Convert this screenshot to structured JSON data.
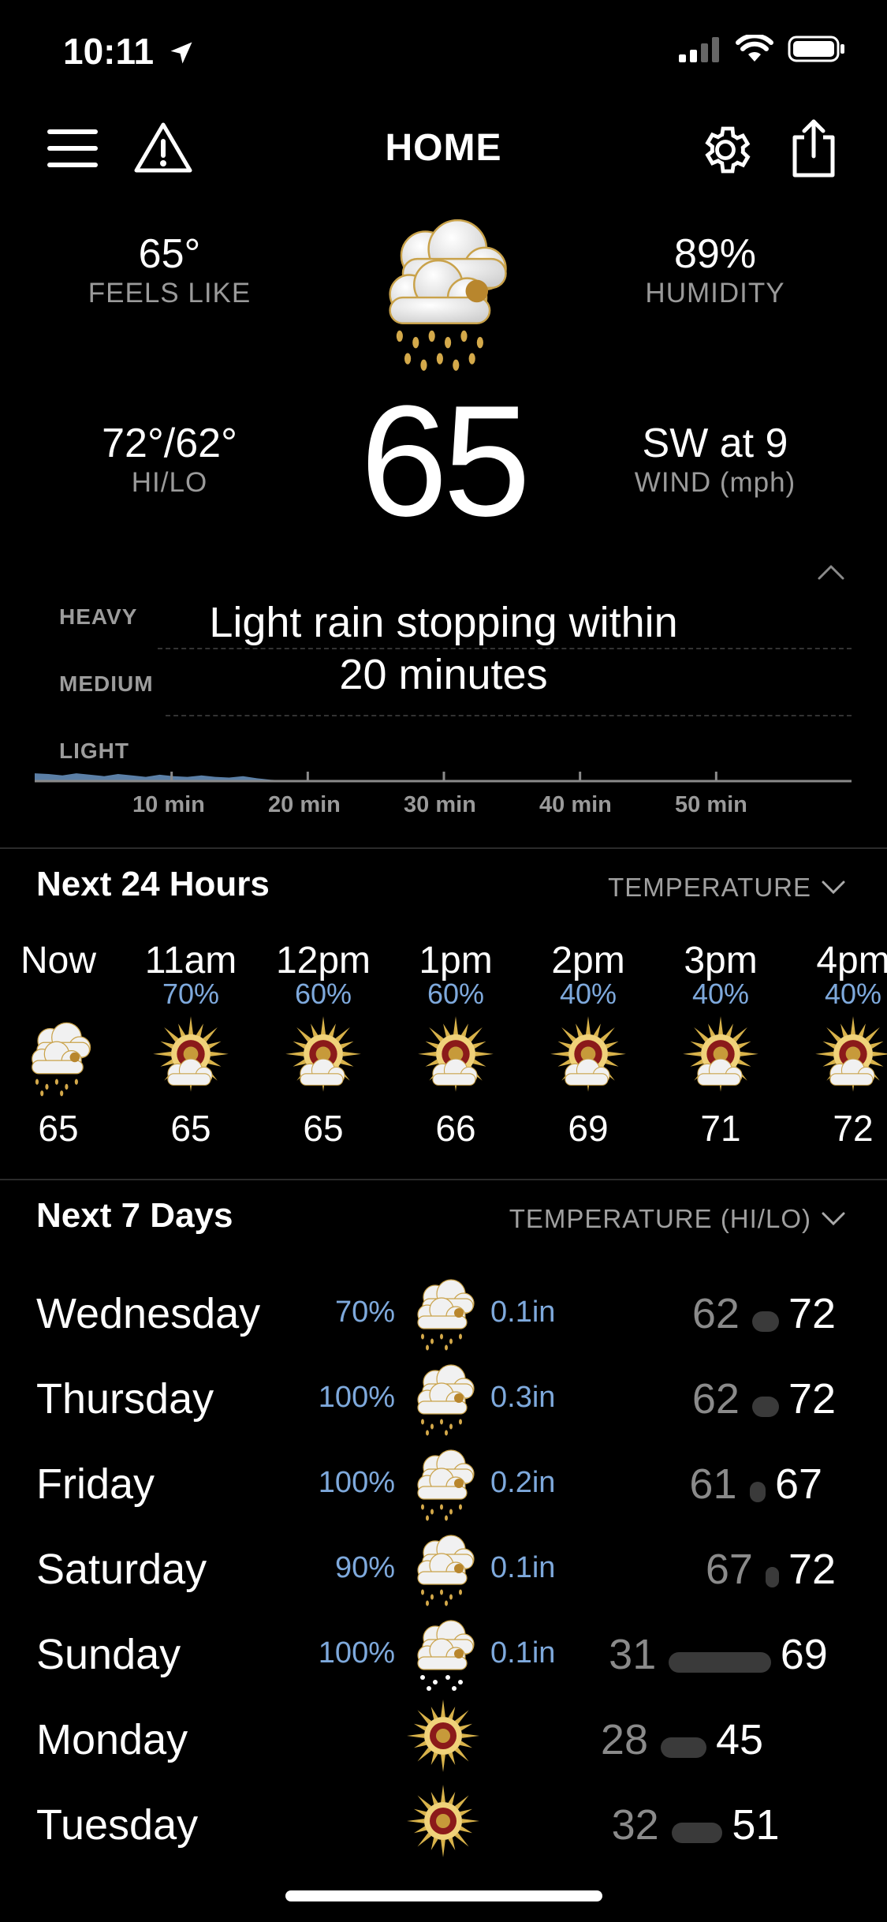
{
  "status": {
    "time": "10:11"
  },
  "header": {
    "title": "HOME"
  },
  "current": {
    "feels_like_value": "65°",
    "feels_like_label": "FEELS LIKE",
    "humidity_value": "89%",
    "humidity_label": "HUMIDITY",
    "hilo_value": "72°/62°",
    "hilo_label": "HI/LO",
    "temperature": "65",
    "wind_value": "SW at 9",
    "wind_label": "WIND (mph)"
  },
  "precip": {
    "levels": [
      "HEAVY",
      "MEDIUM",
      "LIGHT"
    ],
    "message": "Light rain stopping within 20 minutes",
    "ticks": [
      "10 min",
      "20 min",
      "30 min",
      "40 min",
      "50 min"
    ],
    "intensity": [
      0.55,
      0.5,
      0.4,
      0.55,
      0.45,
      0.35,
      0.5,
      0.4,
      0.3,
      0.45,
      0.35,
      0.3,
      0.4,
      0.3,
      0.25,
      0.35,
      0.2,
      0.1,
      0.05,
      0,
      0,
      0,
      0,
      0,
      0
    ]
  },
  "hourly": {
    "title": "Next 24 Hours",
    "selector": "TEMPERATURE",
    "hours": [
      {
        "label": "Now",
        "pct": "",
        "temp": "65",
        "icon": "rain-cloud-icon"
      },
      {
        "label": "11am",
        "pct": "70%",
        "temp": "65",
        "icon": "sun-cloud-icon"
      },
      {
        "label": "12pm",
        "pct": "60%",
        "temp": "65",
        "icon": "sun-cloud-icon"
      },
      {
        "label": "1pm",
        "pct": "60%",
        "temp": "66",
        "icon": "sun-cloud-icon"
      },
      {
        "label": "2pm",
        "pct": "40%",
        "temp": "69",
        "icon": "sun-cloud-icon"
      },
      {
        "label": "3pm",
        "pct": "40%",
        "temp": "71",
        "icon": "sun-cloud-icon"
      },
      {
        "label": "4pm",
        "pct": "40%",
        "temp": "72",
        "icon": "sun-cloud-icon"
      }
    ]
  },
  "daily": {
    "title": "Next 7 Days",
    "selector": "TEMPERATURE (HI/LO)",
    "range": [
      28,
      72
    ],
    "days": [
      {
        "name": "Wednesday",
        "pct": "70%",
        "amount": "0.1in",
        "lo": "62",
        "hi": "72",
        "icon": "rain-cloud-icon"
      },
      {
        "name": "Thursday",
        "pct": "100%",
        "amount": "0.3in",
        "lo": "62",
        "hi": "72",
        "icon": "rain-cloud-icon"
      },
      {
        "name": "Friday",
        "pct": "100%",
        "amount": "0.2in",
        "lo": "61",
        "hi": "67",
        "icon": "rain-cloud-icon"
      },
      {
        "name": "Saturday",
        "pct": "90%",
        "amount": "0.1in",
        "lo": "67",
        "hi": "72",
        "icon": "rain-cloud-icon"
      },
      {
        "name": "Sunday",
        "pct": "100%",
        "amount": "0.1in",
        "lo": "31",
        "hi": "69",
        "icon": "snow-cloud-icon"
      },
      {
        "name": "Monday",
        "pct": "",
        "amount": "",
        "lo": "28",
        "hi": "45",
        "icon": "sun-icon"
      },
      {
        "name": "Tuesday",
        "pct": "",
        "amount": "",
        "lo": "32",
        "hi": "51",
        "icon": "sun-icon"
      }
    ]
  }
}
